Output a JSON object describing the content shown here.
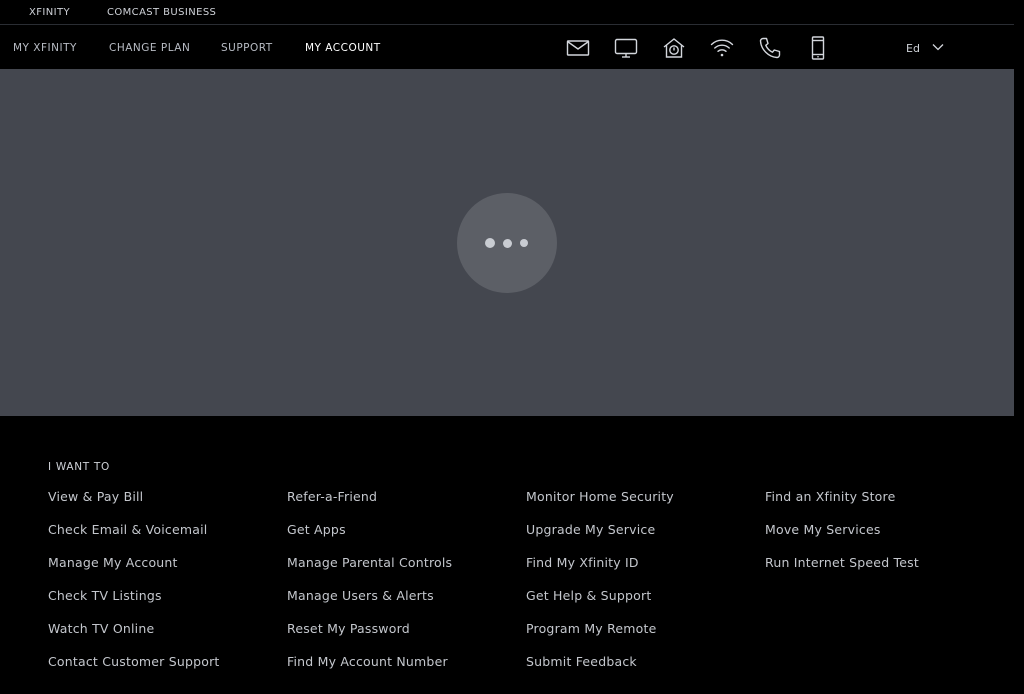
{
  "brand_bar": {
    "links": [
      "XFINITY",
      "COMCAST BUSINESS"
    ]
  },
  "nav": {
    "links": [
      "MY XFINITY",
      "CHANGE PLAN",
      "SUPPORT",
      "MY ACCOUNT"
    ],
    "active": "MY ACCOUNT",
    "icons": [
      "mail-icon",
      "tv-icon",
      "home-security-icon",
      "wifi-icon",
      "phone-icon",
      "mobile-icon"
    ],
    "user_label": "Ed"
  },
  "loading": {
    "indicator": "loading-dots"
  },
  "footer": {
    "heading": "I WANT TO",
    "columns": [
      [
        "View & Pay Bill",
        "Check Email & Voicemail",
        "Manage My Account",
        "Check TV Listings",
        "Watch TV Online",
        "Contact Customer Support"
      ],
      [
        "Refer-a-Friend",
        "Get Apps",
        "Manage Parental Controls",
        "Manage Users & Alerts",
        "Reset My Password",
        "Find My Account Number"
      ],
      [
        "Monitor Home Security",
        "Upgrade My Service",
        "Find My Xfinity ID",
        "Get Help & Support",
        "Program My Remote",
        "Submit Feedback"
      ],
      [
        "Find an Xfinity Store",
        "Move My Services",
        "Run Internet Speed Test"
      ]
    ]
  },
  "colors": {
    "background": "#000000",
    "loading_panel": "#44474f",
    "spinner": "#5c5f66",
    "link_text": "#c4c7cd"
  }
}
